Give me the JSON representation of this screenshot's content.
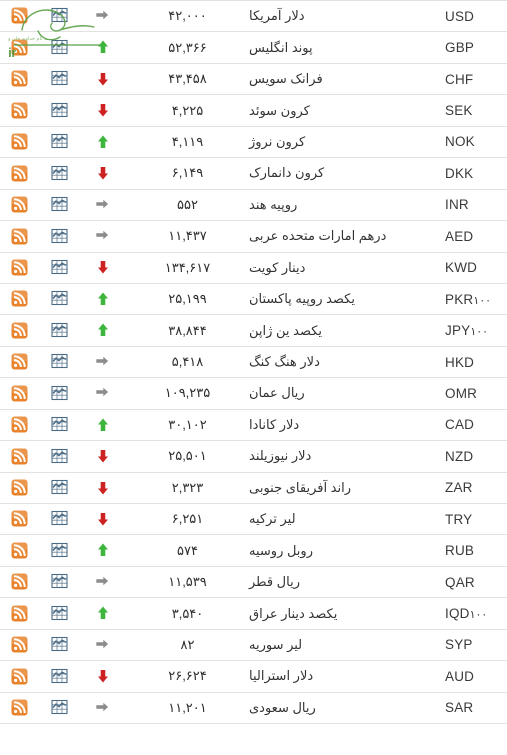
{
  "page": {
    "title": "جدول نرخ ارز",
    "direction": "rtl",
    "watermark_text": "seratnews.ir",
    "watermark_color": "#4f9c3f"
  },
  "colors": {
    "up": "#3eb63e",
    "down": "#cc2222",
    "flat": "#8c8c8c",
    "rss": "#e8822b",
    "chart": "#4a6b86",
    "row_border": "#e2e2e2",
    "text": "#333333"
  },
  "icons": {
    "rss": "rss-feed-icon",
    "chart": "chart-grid-icon",
    "up": "arrow-up-icon",
    "down": "arrow-down-icon",
    "flat": "arrow-right-icon"
  },
  "table": {
    "rows": [
      {
        "code": "USD",
        "code_suffix": "",
        "name": "دلار آمریکا",
        "value": "۴۲,۰۰۰",
        "trend": "flat"
      },
      {
        "code": "GBP",
        "code_suffix": "",
        "name": "پوند انگلیس",
        "value": "۵۲,۳۶۶",
        "trend": "up"
      },
      {
        "code": "CHF",
        "code_suffix": "",
        "name": "فرانک سویس",
        "value": "۴۳,۴۵۸",
        "trend": "down"
      },
      {
        "code": "SEK",
        "code_suffix": "",
        "name": "کرون سوئد",
        "value": "۴,۲۲۵",
        "trend": "down"
      },
      {
        "code": "NOK",
        "code_suffix": "",
        "name": "کرون نروژ",
        "value": "۴,۱۱۹",
        "trend": "up"
      },
      {
        "code": "DKK",
        "code_suffix": "",
        "name": "کرون دانمارک",
        "value": "۶,۱۴۹",
        "trend": "down"
      },
      {
        "code": "INR",
        "code_suffix": "",
        "name": "روپیه هند",
        "value": "۵۵۲",
        "trend": "flat"
      },
      {
        "code": "AED",
        "code_suffix": "",
        "name": "درهم امارات متحده عربی",
        "value": "۱۱,۴۳۷",
        "trend": "flat"
      },
      {
        "code": "KWD",
        "code_suffix": "",
        "name": "دینار کویت",
        "value": "۱۳۴,۶۱۷",
        "trend": "down"
      },
      {
        "code": "PKR",
        "code_suffix": "۱۰۰",
        "name": "یکصد روپیه پاکستان",
        "value": "۲۵,۱۹۹",
        "trend": "up"
      },
      {
        "code": "JPY",
        "code_suffix": "۱۰۰",
        "name": "یکصد ین ژاپن",
        "value": "۳۸,۸۴۴",
        "trend": "up"
      },
      {
        "code": "HKD",
        "code_suffix": "",
        "name": "دلار هنگ کنگ",
        "value": "۵,۴۱۸",
        "trend": "flat"
      },
      {
        "code": "OMR",
        "code_suffix": "",
        "name": "ریال عمان",
        "value": "۱۰۹,۲۳۵",
        "trend": "flat"
      },
      {
        "code": "CAD",
        "code_suffix": "",
        "name": "دلار کانادا",
        "value": "۳۰,۱۰۲",
        "trend": "up"
      },
      {
        "code": "NZD",
        "code_suffix": "",
        "name": "دلار نیوزیلند",
        "value": "۲۵,۵۰۱",
        "trend": "down"
      },
      {
        "code": "ZAR",
        "code_suffix": "",
        "name": "راند آفریقای جنوبی",
        "value": "۲,۳۲۳",
        "trend": "down"
      },
      {
        "code": "TRY",
        "code_suffix": "",
        "name": "لیر ترکیه",
        "value": "۶,۲۵۱",
        "trend": "down"
      },
      {
        "code": "RUB",
        "code_suffix": "",
        "name": "روبل روسیه",
        "value": "۵۷۴",
        "trend": "up"
      },
      {
        "code": "QAR",
        "code_suffix": "",
        "name": "ریال قطر",
        "value": "۱۱,۵۳۹",
        "trend": "flat"
      },
      {
        "code": "IQD",
        "code_suffix": "۱۰۰",
        "name": "یکصد دینار عراق",
        "value": "۳,۵۴۰",
        "trend": "up"
      },
      {
        "code": "SYP",
        "code_suffix": "",
        "name": "لیر سوریه",
        "value": "۸۲",
        "trend": "flat"
      },
      {
        "code": "AUD",
        "code_suffix": "",
        "name": "دلار استرالیا",
        "value": "۲۶,۶۲۴",
        "trend": "down"
      },
      {
        "code": "SAR",
        "code_suffix": "",
        "name": "ریال سعودی",
        "value": "۱۱,۲۰۱",
        "trend": "flat"
      }
    ]
  }
}
